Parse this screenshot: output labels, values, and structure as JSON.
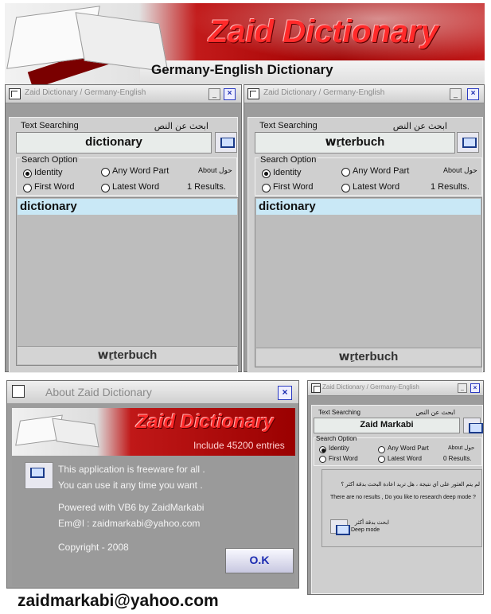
{
  "banner": {
    "title": "Zaid Dictionary",
    "subtitle": "Germany-English Dictionary"
  },
  "windows": [
    {
      "title": "Zaid Dictionary / Germany-English",
      "text_searching": "Text Searching",
      "text_searching_ar": "ابحث عن النص",
      "search_value": "dictionary",
      "search_option": "Search Option",
      "opt_identity": "Identity",
      "opt_any_word": "Any Word Part",
      "opt_first": "First Word",
      "opt_latest": "Latest Word",
      "about": "About حول",
      "results": "1 Results.",
      "selected_identity": true,
      "list_item": "dictionary",
      "translation": "wِrterbuch"
    },
    {
      "title": "Zaid Dictionary / Germany-English",
      "text_searching": "Text Searching",
      "text_searching_ar": "ابحث عن النص",
      "search_value": "wِrterbuch",
      "search_option": "Search Option",
      "opt_identity": "Identity",
      "opt_any_word": "Any Word Part",
      "opt_first": "First Word",
      "opt_latest": "Latest Word",
      "about": "About حول",
      "results": "1 Results.",
      "selected_identity": true,
      "list_item": "dictionary",
      "translation": "wِrterbuch"
    }
  ],
  "about_dialog": {
    "title": "About Zaid Dictionary",
    "banner_title": "Zaid Dictionary",
    "banner_sub": "Include 45200 entries",
    "line1": "This application is freeware for all .",
    "line2": "You can use it any time you want .",
    "line3": "Powered with VB6 by ZaidMarkabi",
    "line4": "Em@l : zaidmarkabi@yahoo.com",
    "line5": "Copyright - 2008",
    "ok": "O.K"
  },
  "small_window": {
    "title": "Zaid Dictionary / Germany-English",
    "text_searching": "Text Searching",
    "text_searching_ar": "ابحث عن النص",
    "search_value": "Zaid Markabi",
    "search_option": "Search Option",
    "opt_identity": "Identity",
    "opt_any_word": "Any Word Part",
    "opt_first": "First Word",
    "opt_latest": "Latest Word",
    "about": "About حول",
    "results": "0 Results.",
    "msg_ar": "لم يتم العثور على أي نتيجة ، هل تريد اعادة البحث بدقة أكثر ؟",
    "msg_en": "There are no results , Do you like to research deep mode ?",
    "deep_ar": "ابحث بدقة أكثر",
    "deep_en": "Deep mode"
  },
  "footer": {
    "email": "zaidmarkabi@yahoo.com"
  },
  "colors": {
    "accent_red": "#c21a1a",
    "window_gray": "#9c9c9c",
    "selection_blue": "#c9e8f6",
    "button_blue": "#1a2ab0"
  }
}
